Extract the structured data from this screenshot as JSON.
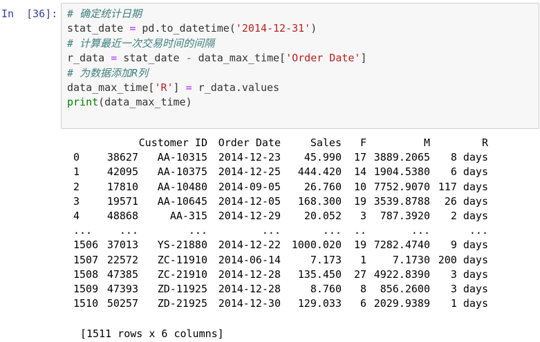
{
  "prompt": "In  [36]:",
  "code_lines": [
    [
      {
        "t": "# 确定统计日期",
        "c": "comment"
      }
    ],
    [
      {
        "t": "stat_date ",
        "c": ""
      },
      {
        "t": "=",
        "c": "op"
      },
      {
        "t": " pd.to_datetime(",
        "c": ""
      },
      {
        "t": "'2014-12-31'",
        "c": "str"
      },
      {
        "t": ")",
        "c": ""
      }
    ],
    [
      {
        "t": "# 计算最近一次交易时间的间隔",
        "c": "comment"
      }
    ],
    [
      {
        "t": "r_data ",
        "c": ""
      },
      {
        "t": "=",
        "c": "op"
      },
      {
        "t": " stat_date ",
        "c": ""
      },
      {
        "t": "-",
        "c": "op"
      },
      {
        "t": " data_max_time[",
        "c": ""
      },
      {
        "t": "'Order Date'",
        "c": "str"
      },
      {
        "t": "]",
        "c": ""
      }
    ],
    [
      {
        "t": "# 为数据添加R列",
        "c": "comment"
      }
    ],
    [
      {
        "t": "data_max_time[",
        "c": ""
      },
      {
        "t": "'R'",
        "c": "str"
      },
      {
        "t": "] ",
        "c": ""
      },
      {
        "t": "=",
        "c": "op"
      },
      {
        "t": " r_data.values",
        "c": ""
      }
    ],
    [
      {
        "t": "print",
        "c": "builtin"
      },
      {
        "t": "(data_max_time)",
        "c": ""
      }
    ]
  ],
  "table": {
    "columns": [
      "",
      "",
      "Customer ID",
      "Order Date",
      "Sales",
      "F",
      "M",
      "R"
    ],
    "rows": [
      [
        "0",
        "38627",
        "AA-10315",
        "2014-12-23",
        "45.990",
        "17",
        "3889.2065",
        "8 days"
      ],
      [
        "1",
        "42095",
        "AA-10375",
        "2014-12-25",
        "444.420",
        "14",
        "1904.5380",
        "6 days"
      ],
      [
        "2",
        "17810",
        "AA-10480",
        "2014-09-05",
        "26.760",
        "10",
        "7752.9070",
        "117 days"
      ],
      [
        "3",
        "19571",
        "AA-10645",
        "2014-12-05",
        "168.300",
        "19",
        "3539.8788",
        "26 days"
      ],
      [
        "4",
        "48868",
        "AA-315",
        "2014-12-29",
        "20.052",
        "3",
        "787.3920",
        "2 days"
      ],
      [
        "...",
        "...",
        "...",
        "...",
        "...",
        "..",
        "...",
        "..."
      ],
      [
        "1506",
        "37013",
        "YS-21880",
        "2014-12-22",
        "1000.020",
        "19",
        "7282.4740",
        "9 days"
      ],
      [
        "1507",
        "22572",
        "ZC-11910",
        "2014-06-14",
        "7.173",
        "1",
        "7.1730",
        "200 days"
      ],
      [
        "1508",
        "47385",
        "ZC-21910",
        "2014-12-28",
        "135.450",
        "27",
        "4922.8390",
        "3 days"
      ],
      [
        "1509",
        "47393",
        "ZD-11925",
        "2014-12-28",
        "8.760",
        "8",
        "856.2600",
        "3 days"
      ],
      [
        "1510",
        "50257",
        "ZD-21925",
        "2014-12-30",
        "129.033",
        "6",
        "2029.9389",
        "1 days"
      ]
    ]
  },
  "summary": "[1511 rows x 6 columns]"
}
